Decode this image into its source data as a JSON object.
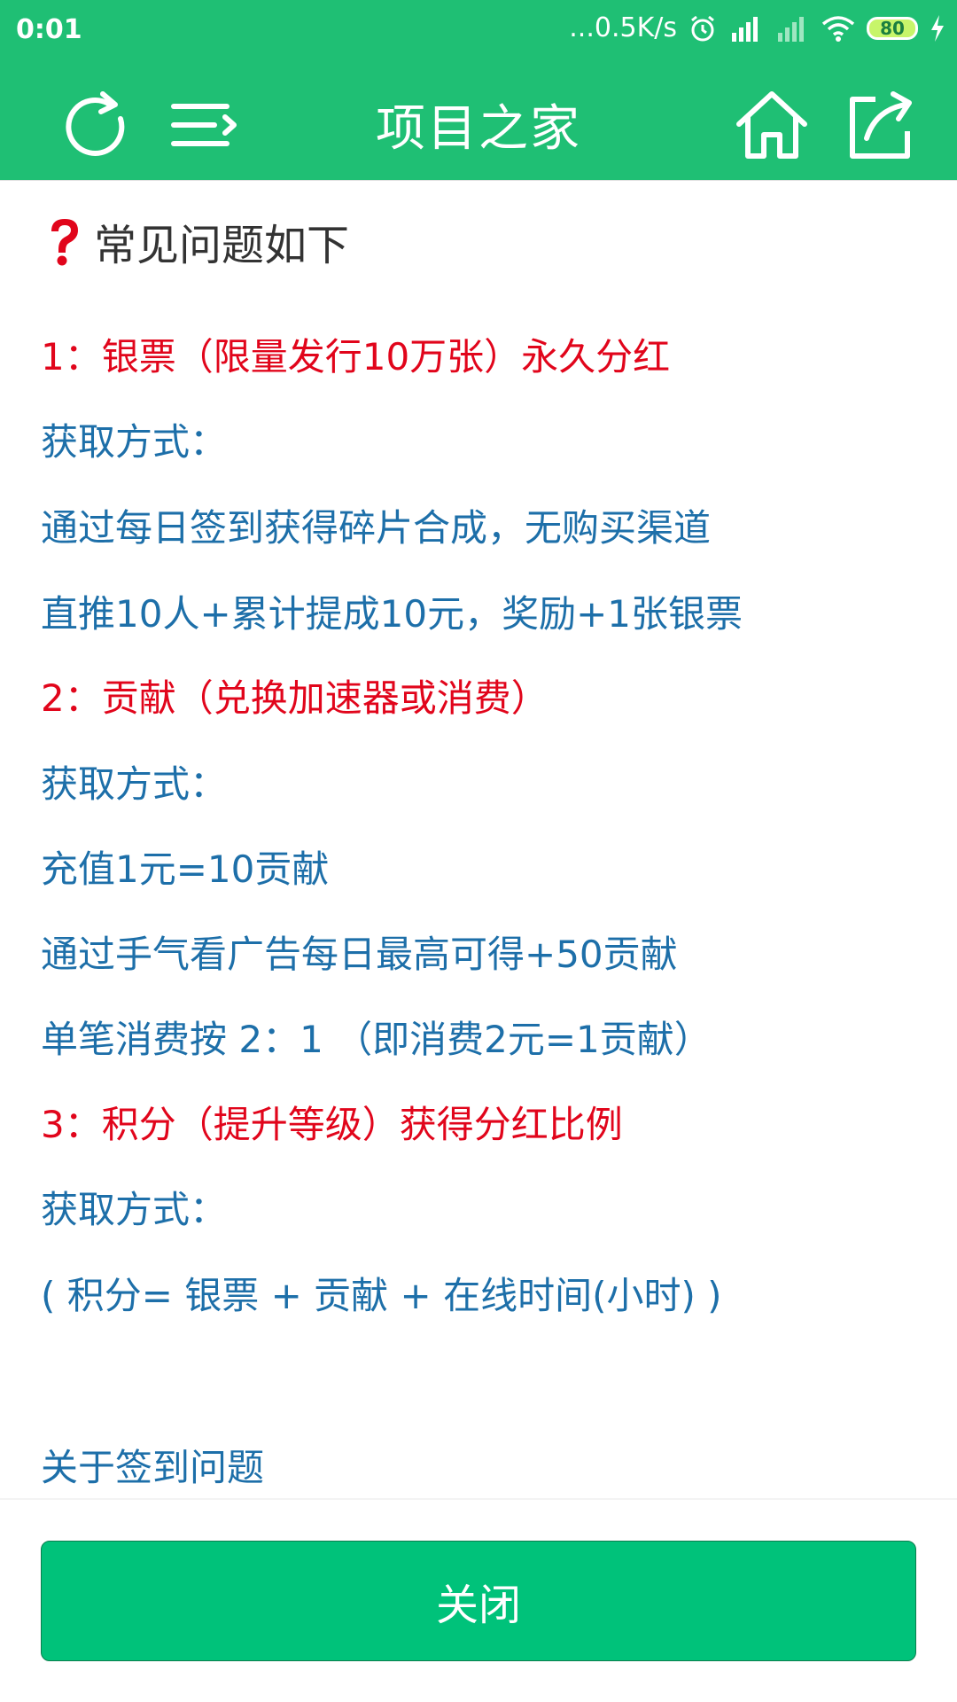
{
  "status_bar": {
    "time": "0:01",
    "network_speed": "...0.5K/s",
    "battery": "80"
  },
  "app_bar": {
    "title": "项目之家"
  },
  "content": {
    "heading": "常见问题如下",
    "lines": [
      {
        "text": "1：银票（限量发行10万张）永久分红",
        "style": "red"
      },
      {
        "text": "获取方式：",
        "style": "blue"
      },
      {
        "text": "通过每日签到获得碎片合成，无购买渠道",
        "style": "blue"
      },
      {
        "text": "直推10人+累计提成10元，奖励+1张银票",
        "style": "blue"
      },
      {
        "text": "2：贡献（兑换加速器或消费）",
        "style": "red"
      },
      {
        "text": "获取方式：",
        "style": "blue"
      },
      {
        "text": "充值1元=10贡献",
        "style": "blue"
      },
      {
        "text": "通过手气看广告每日最高可得+50贡献",
        "style": "blue"
      },
      {
        "text": "单笔消费按 2：1 （即消费2元=1贡献）",
        "style": "blue"
      },
      {
        "text": "3：积分（提升等级）获得分红比例",
        "style": "red"
      },
      {
        "text": "获取方式：",
        "style": "blue"
      },
      {
        "text": "( 积分= 银票 + 贡献 + 在线时间(小时) )",
        "style": "blue"
      },
      {
        "text": "关于签到问题",
        "style": "blue"
      }
    ]
  },
  "close_button": {
    "label": "关闭"
  },
  "colors": {
    "brand_green": "#1fbf74",
    "button_green": "#00c27a",
    "red_text": "#e1051b",
    "blue_text": "#1d6fa9"
  },
  "icons": {
    "refresh": "refresh-icon",
    "menu": "menu-icon",
    "home": "home-icon",
    "share": "share-icon",
    "question": "question-mark-icon"
  }
}
